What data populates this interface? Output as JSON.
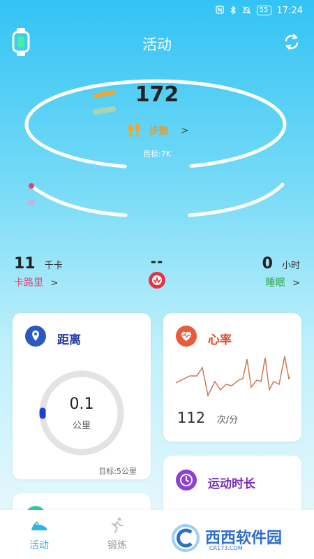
{
  "status_bar": {
    "time": "17:24",
    "battery": "55",
    "icons": [
      "nfc-icon",
      "bluetooth-icon",
      "mute-bell-icon",
      "battery-icon"
    ]
  },
  "header": {
    "title": "活动",
    "left_icon": "watch-icon",
    "right_icon": "refresh-icon"
  },
  "steps": {
    "value": "172",
    "label": "步数",
    "arrow": ">",
    "goal": "目标:7K",
    "icon": "footprints-icon"
  },
  "calories": {
    "value": "11",
    "unit": "千卡",
    "label": "卡路里",
    "arrow": ">"
  },
  "center_metric": {
    "value": "--",
    "icon": "medal-icon"
  },
  "sleep": {
    "value": "0",
    "unit": "小时",
    "label": "睡眠",
    "arrow": ">"
  },
  "distance_card": {
    "title": "距离",
    "value": "0.1",
    "unit": "公里",
    "goal": "目标:5公里",
    "progress": 0.02,
    "icon": "location-pin-icon"
  },
  "heart_card": {
    "title": "心率",
    "value": "112",
    "unit": "次/分",
    "icon": "heart-pulse-icon"
  },
  "duration_card": {
    "title": "运动时长",
    "icon": "clock-icon"
  },
  "tabs": [
    {
      "label": "活动",
      "icon": "shoe-icon",
      "active": true
    },
    {
      "label": "锻炼",
      "icon": "runner-icon",
      "active": false
    }
  ],
  "watermark": {
    "text": "西西软件园",
    "sub": "CR173.COM"
  },
  "colors": {
    "steps": "#e89a2b",
    "calories": "#e0447a",
    "sleep": "#2ea64a",
    "distance": "#1f3aa3",
    "heart": "#e04a2a",
    "duration": "#7a2dbd",
    "active_tab": "#2fb3e6"
  }
}
